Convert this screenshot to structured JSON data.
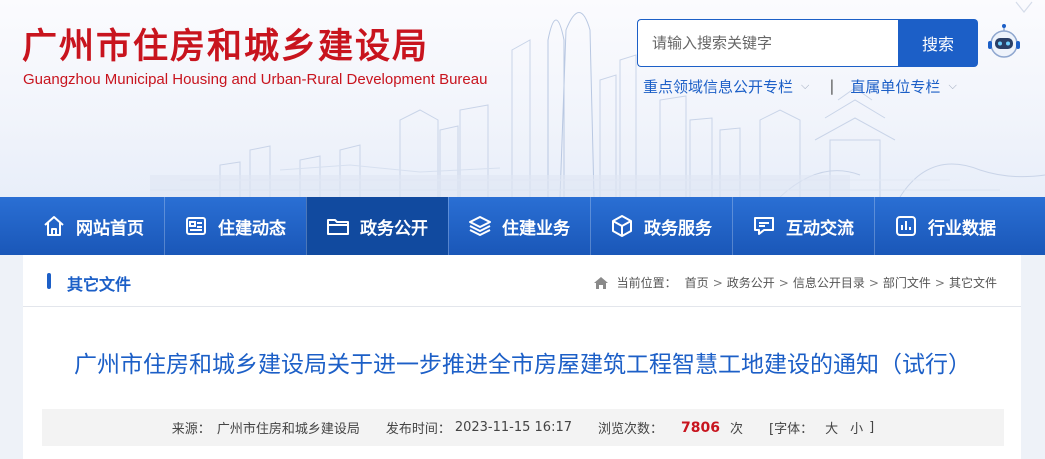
{
  "header": {
    "title": "广州市住房和城乡建设局",
    "subtitle": "Guangzhou Municipal Housing and Urban-Rural Development Bureau",
    "search": {
      "placeholder": "请输入搜索关键字",
      "button_label": "搜索"
    },
    "quick_links": [
      {
        "label": "重点领域信息公开专栏"
      },
      {
        "label": "直属单位专栏"
      }
    ],
    "separator": "|"
  },
  "nav": {
    "items": [
      {
        "label": "网站首页",
        "icon": "home-icon"
      },
      {
        "label": "住建动态",
        "icon": "news-icon"
      },
      {
        "label": "政务公开",
        "icon": "folder-icon",
        "active": true
      },
      {
        "label": "住建业务",
        "icon": "layers-icon"
      },
      {
        "label": "政务服务",
        "icon": "cube-icon"
      },
      {
        "label": "互动交流",
        "icon": "chat-icon"
      },
      {
        "label": "行业数据",
        "icon": "chart-icon"
      }
    ]
  },
  "section": {
    "title": "其它文件"
  },
  "breadcrumb": {
    "prefix": "当前位置：",
    "items": [
      "首页",
      "政务公开",
      "信息公开目录",
      "部门文件",
      "其它文件"
    ],
    "arrow": ">"
  },
  "article": {
    "title": "广州市住房和城乡建设局关于进一步推进全市房屋建筑工程智慧工地建设的通知（试行）",
    "meta": {
      "source_label": "来源：",
      "source": "广州市住房和城乡建设局",
      "time_label": "发布时间：",
      "time": "2023-11-15 16:17",
      "views_label": "浏览次数：",
      "views": "7806",
      "views_unit": "次",
      "font_label": "[字体：",
      "font_large": "大",
      "font_small": "小",
      "font_close": "]"
    }
  },
  "colors": {
    "brand_red": "#c8141e",
    "brand_blue": "#1c5fc7",
    "nav_active": "#114a9f"
  }
}
